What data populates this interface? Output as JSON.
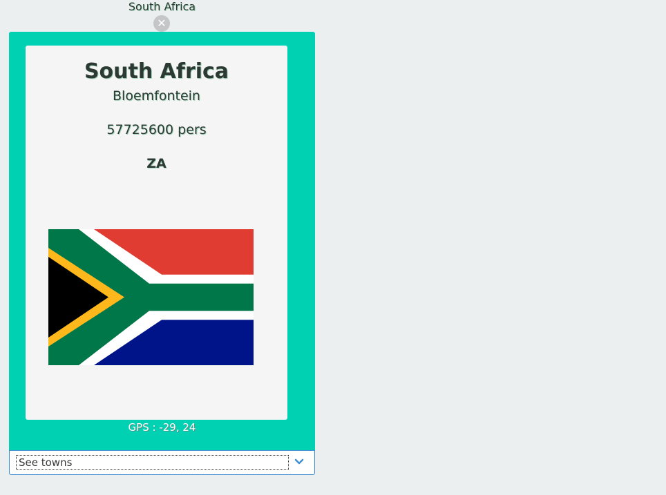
{
  "header": {
    "title": "South Africa",
    "close_icon": "close-icon"
  },
  "card": {
    "country": "South Africa",
    "capital": "Bloemfontein",
    "population": "57725600 pers",
    "code": "ZA",
    "flag": "south-africa-flag"
  },
  "gps": {
    "text": "GPS : -29, 24"
  },
  "towns_select": {
    "selected": "See towns",
    "icon": "chevron-down-icon"
  },
  "colors": {
    "panel": "#00d1b2",
    "card": "#f5f5f5",
    "select_border": "#3e8ed0",
    "flag_red": "#e03c31",
    "flag_green": "#007749",
    "flag_blue": "#001489",
    "flag_gold": "#ffb81c",
    "flag_black": "#000000"
  }
}
